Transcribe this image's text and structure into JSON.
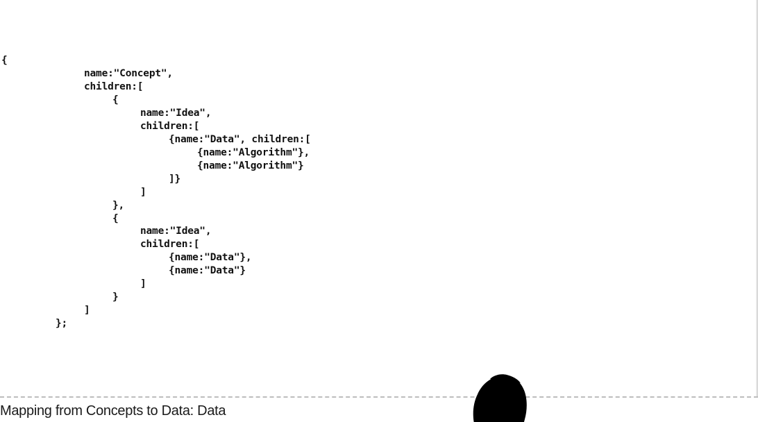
{
  "slide": {
    "code_lines": [
      "{",
      "name:\"Concept\",",
      "children:[",
      "{",
      "name:\"Idea\",",
      "children:[",
      "{name:\"Data\", children:[",
      "{name:\"Algorithm\"},",
      "{name:\"Algorithm\"}",
      "]}",
      "]",
      "},",
      "{",
      "name:\"Idea\",",
      "children:[",
      "{name:\"Data\"},",
      "{name:\"Data\"}",
      "]",
      "}",
      "]",
      "};"
    ],
    "footer_title": "Mapping from Concepts to Data: Data"
  }
}
